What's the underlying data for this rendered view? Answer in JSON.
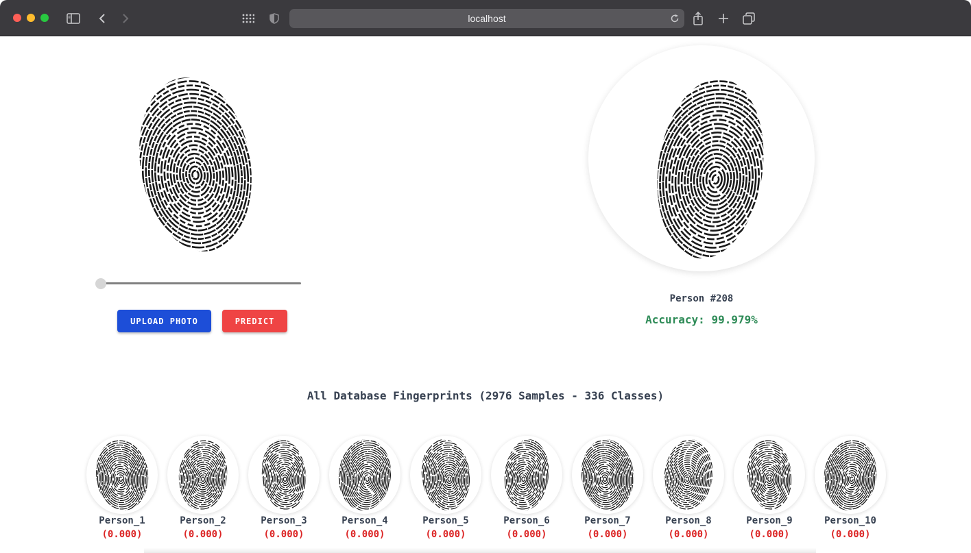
{
  "browser": {
    "address": "localhost",
    "colors": {
      "chrome": "#3b3a3e",
      "address_bar": "#58575b"
    }
  },
  "uploader": {
    "upload_label": "UPLOAD PHOTO",
    "predict_label": "PREDICT",
    "colors": {
      "upload": "#1d4ed8",
      "predict": "#ef4444"
    },
    "image_icon": "fingerprint-icon"
  },
  "result": {
    "person": "Person #208",
    "accuracy": "Accuracy: 99.979%",
    "accuracy_color": "#2e8b57"
  },
  "database": {
    "title": "All Database Fingerprints (2976 Samples - 336 Classes)",
    "items": [
      {
        "name": "Person_1",
        "score": "(0.000)"
      },
      {
        "name": "Person_2",
        "score": "(0.000)"
      },
      {
        "name": "Person_3",
        "score": "(0.000)"
      },
      {
        "name": "Person_4",
        "score": "(0.000)"
      },
      {
        "name": "Person_5",
        "score": "(0.000)"
      },
      {
        "name": "Person_6",
        "score": "(0.000)"
      },
      {
        "name": "Person_7",
        "score": "(0.000)"
      },
      {
        "name": "Person_8",
        "score": "(0.000)"
      },
      {
        "name": "Person_9",
        "score": "(0.000)"
      },
      {
        "name": "Person_10",
        "score": "(0.000)"
      }
    ]
  }
}
